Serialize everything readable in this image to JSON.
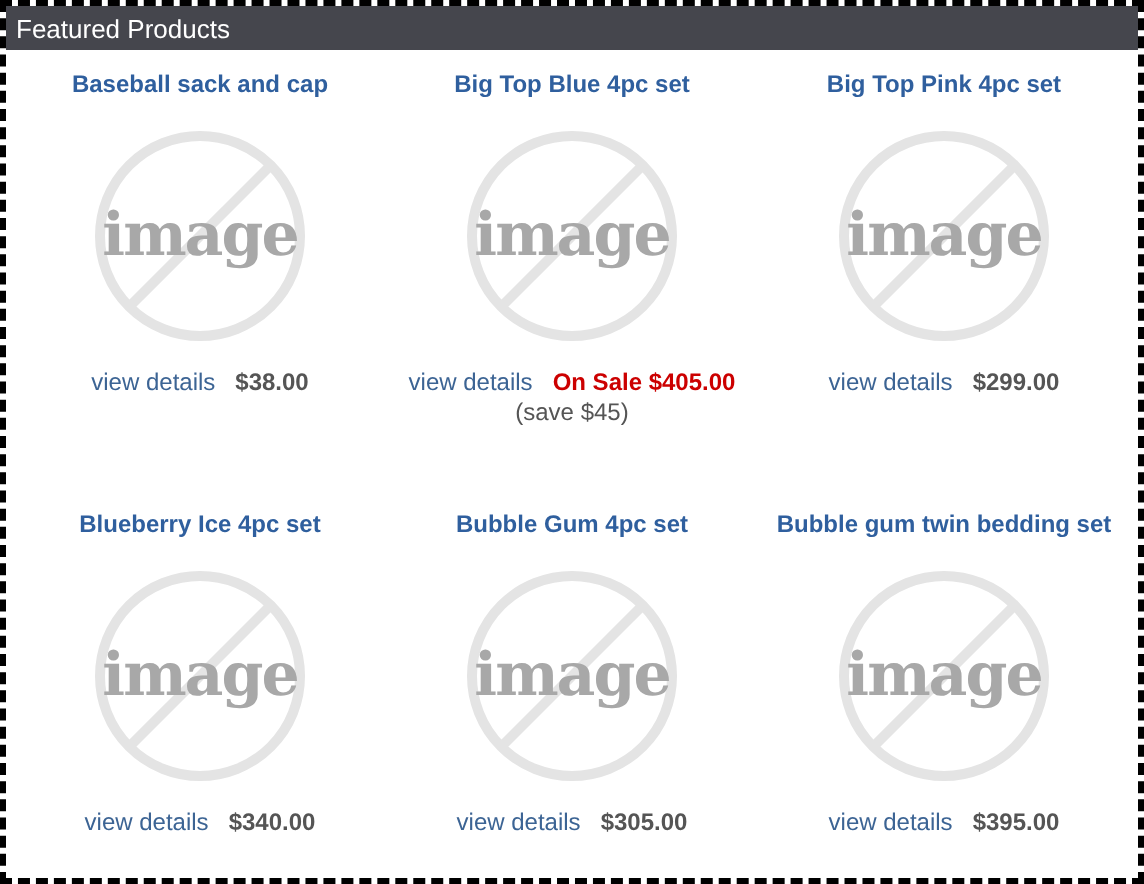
{
  "panel": {
    "title": "Featured Products"
  },
  "products": [
    {
      "name": "Baseball sack and cap",
      "image_text": "image",
      "link": "view details",
      "price": "$38.00",
      "on_sale": false
    },
    {
      "name": "Big Top Blue 4pc set",
      "image_text": "image",
      "link": "view details",
      "price": "On Sale $405.00",
      "on_sale": true,
      "savings": "(save $45)"
    },
    {
      "name": "Big Top Pink 4pc set",
      "image_text": "image",
      "link": "view details",
      "price": "$299.00",
      "on_sale": false
    },
    {
      "name": "Blueberry Ice 4pc set",
      "image_text": "image",
      "link": "view details",
      "price": "$340.00",
      "on_sale": false
    },
    {
      "name": "Bubble Gum 4pc set",
      "image_text": "image",
      "link": "view details",
      "price": "$305.00",
      "on_sale": false
    },
    {
      "name": "Bubble gum twin bedding set",
      "image_text": "image",
      "link": "view details",
      "price": "$395.00",
      "on_sale": false
    }
  ]
}
